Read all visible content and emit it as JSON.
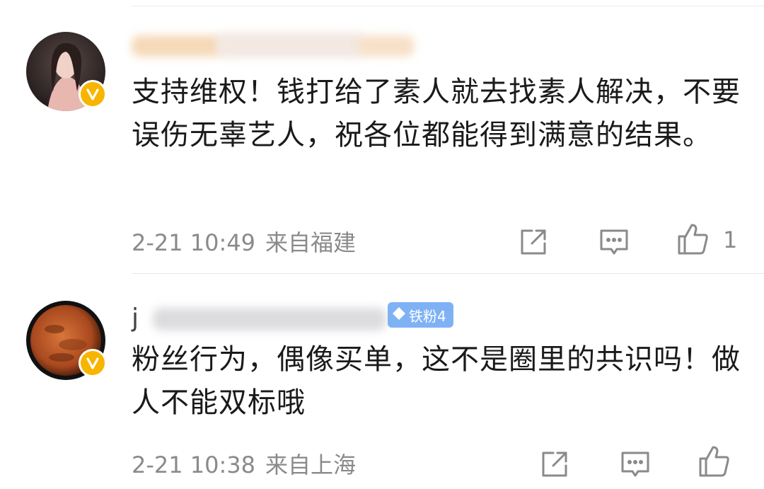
{
  "comments": [
    {
      "username_visible": "",
      "text": "支持维权！钱打给了素人就去找素人解决，不要误伤无辜艺人，祝各位都能得到满意的结果。",
      "time": "2-21 10:49",
      "location": "来自福建",
      "like_count": "1",
      "verified": true
    },
    {
      "username_visible": "j",
      "fan_badge": "铁粉4",
      "text": "粉丝行为，偶像买单，这不是圈里的共识吗！做人不能双标哦",
      "time": "2-21 10:38",
      "location": "来自上海",
      "like_count": "",
      "verified": true
    }
  ],
  "icons": {
    "share": "share-icon",
    "comment": "comment-icon",
    "like": "thumbs-up-icon",
    "verified": "verified-v-icon",
    "fan": "diamond-icon"
  },
  "colors": {
    "badge_gold": "#f7b500",
    "fan_badge_blue": "#7fb2f5",
    "meta_gray": "#8a8a8a",
    "text": "#1a1a1a"
  }
}
